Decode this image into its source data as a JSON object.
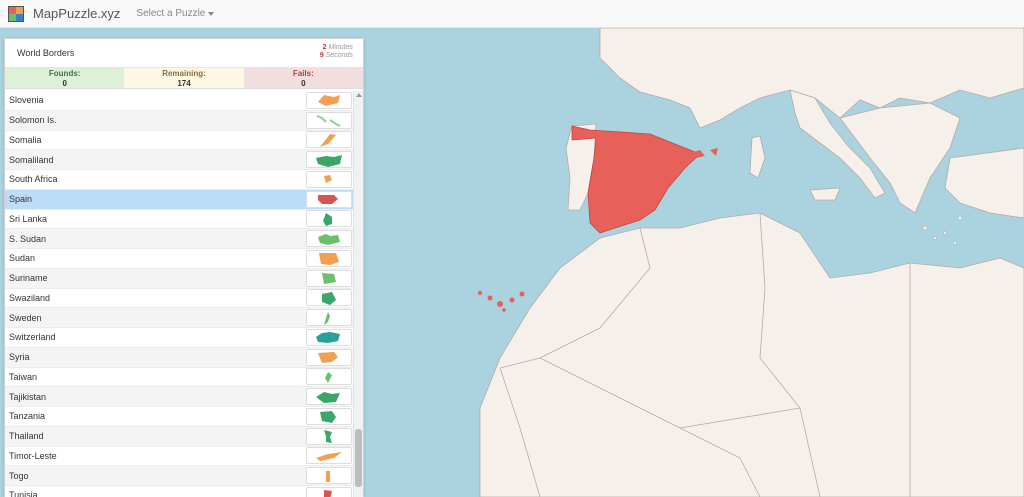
{
  "nav": {
    "brand": "MapPuzzle.xyz",
    "menu_label": "Select a Puzzle"
  },
  "panel": {
    "title": "World Borders",
    "timer": {
      "minutes": "2",
      "minutes_label": "Minutes",
      "seconds": "9",
      "seconds_label": "Seconds"
    },
    "stats": {
      "found_label": "Founds:",
      "found_value": "0",
      "remaining_label": "Remaining:",
      "remaining_value": "174",
      "fail_label": "Fails:",
      "fail_value": "0"
    }
  },
  "countries": [
    {
      "name": "Slovenia",
      "color": "#f0a050"
    },
    {
      "name": "Solomon Is.",
      "color": "#8fd18a"
    },
    {
      "name": "Somalia",
      "color": "#f0a050"
    },
    {
      "name": "Somaliland",
      "color": "#3aa66a"
    },
    {
      "name": "South Africa",
      "color": "#f0a050"
    },
    {
      "name": "Spain",
      "color": "#d9534f",
      "selected": true
    },
    {
      "name": "Sri Lanka",
      "color": "#3aa66a"
    },
    {
      "name": "S. Sudan",
      "color": "#6cc06c"
    },
    {
      "name": "Sudan",
      "color": "#f0a050"
    },
    {
      "name": "Suriname",
      "color": "#6cc06c"
    },
    {
      "name": "Swaziland",
      "color": "#3aa66a"
    },
    {
      "name": "Sweden",
      "color": "#6cc06c"
    },
    {
      "name": "Switzerland",
      "color": "#2aa198"
    },
    {
      "name": "Syria",
      "color": "#f0a050"
    },
    {
      "name": "Taiwan",
      "color": "#6cc06c"
    },
    {
      "name": "Tajikistan",
      "color": "#3aa66a"
    },
    {
      "name": "Tanzania",
      "color": "#3aa66a"
    },
    {
      "name": "Thailand",
      "color": "#3aa66a"
    },
    {
      "name": "Timor-Leste",
      "color": "#f0a050"
    },
    {
      "name": "Togo",
      "color": "#f0a050"
    },
    {
      "name": "Tunisia",
      "color": "#d9534f"
    }
  ],
  "colors": {
    "sea": "#aad3df",
    "land": "#f5f1ea",
    "spain": "#e8605a",
    "border": "#b5aaa8"
  }
}
